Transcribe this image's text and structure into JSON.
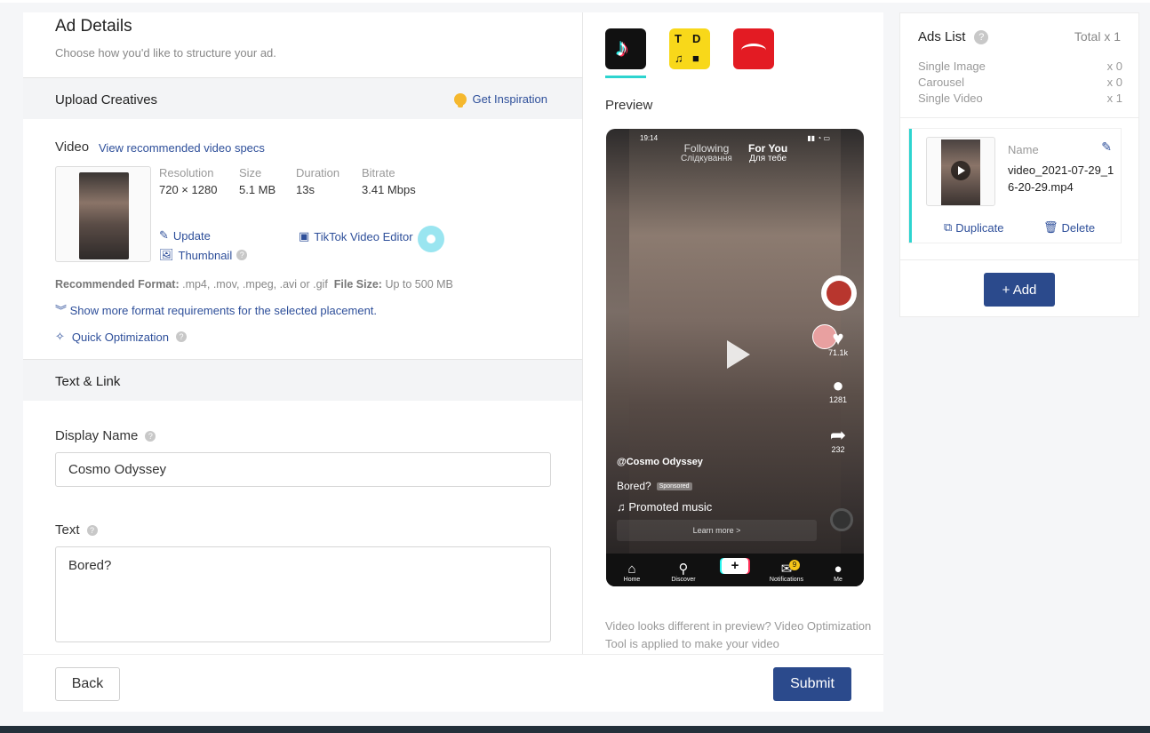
{
  "ad_details": {
    "title": "Ad Details",
    "subtitle": "Choose how you'd like to structure your ad."
  },
  "upload": {
    "section_title": "Upload Creatives",
    "inspiration": "Get Inspiration",
    "video_label": "Video",
    "spec_link": "View recommended video specs",
    "meta": [
      {
        "key": "Resolution",
        "value": "720 × 1280"
      },
      {
        "key": "Size",
        "value": "5.1 MB"
      },
      {
        "key": "Duration",
        "value": "13s"
      },
      {
        "key": "Bitrate",
        "value": "3.41 Mbps"
      }
    ],
    "update": "Update",
    "thumbnail": "Thumbnail",
    "editor": "TikTok Video Editor",
    "format_label": "Recommended Format:",
    "format_value": ".mp4, .mov, .mpeg, .avi or .gif",
    "filesize_label": "File Size:",
    "filesize_value": "Up to 500 MB",
    "show_more": "Show more format requirements for the selected placement.",
    "quick_opt": "Quick Optimization"
  },
  "text_link": {
    "section_title": "Text & Link",
    "display_name_label": "Display Name",
    "display_name_value": "Cosmo Odyssey",
    "text_label": "Text",
    "text_value": "Bored?"
  },
  "footer": {
    "back": "Back",
    "submit": "Submit"
  },
  "preview": {
    "label": "Preview",
    "status_time": "19:14",
    "tab_following": "Following",
    "tab_following_sub": "Слідкування",
    "tab_foryou": "For You",
    "tab_foryou_sub": "Для тебе",
    "likes": "71.1k",
    "comments": "1281",
    "shares": "232",
    "handle": "@Cosmo Odyssey",
    "caption": "Bored?",
    "sponsored": "Sponsored",
    "music": "Promoted music",
    "learn_more": "Learn more >",
    "nav": [
      "Home",
      "Discover",
      "Notifications",
      "Me"
    ],
    "notif_badge": "9",
    "note": "Video looks different in preview? Video Optimization Tool is applied to make your video"
  },
  "ads_list": {
    "title": "Ads List",
    "total": "Total x 1",
    "rows": [
      {
        "label": "Single Image",
        "count": "x 0"
      },
      {
        "label": "Carousel",
        "count": "x 0"
      },
      {
        "label": "Single Video",
        "count": "x 1"
      }
    ],
    "name_label": "Name",
    "name_value": "video_2021-07-29_16-20-29.mp4",
    "duplicate": "Duplicate",
    "delete": "Delete",
    "add": "+ Add"
  },
  "colors": {
    "primary": "#2b4a8c",
    "link": "#2e4f9a",
    "accent_teal": "#2dd4cf"
  }
}
